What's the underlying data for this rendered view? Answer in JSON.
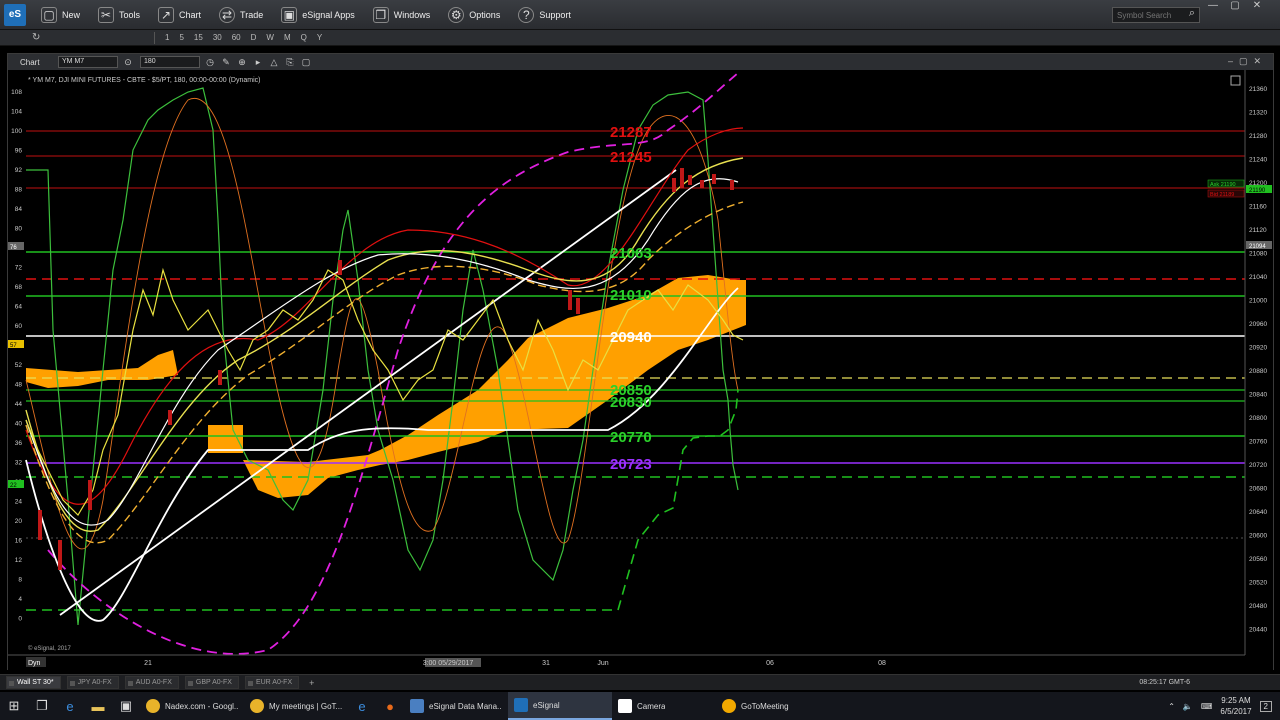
{
  "menubar": {
    "logo": "eS",
    "items": [
      {
        "label": "New",
        "icon": "new-icon"
      },
      {
        "label": "Tools",
        "icon": "tools-icon"
      },
      {
        "label": "Chart",
        "icon": "chart-icon"
      },
      {
        "label": "Trade",
        "icon": "trade-icon"
      },
      {
        "label": "eSignal Apps",
        "icon": "apps-icon"
      },
      {
        "label": "Windows",
        "icon": "windows-icon"
      },
      {
        "label": "Options",
        "icon": "options-icon"
      },
      {
        "label": "Support",
        "icon": "support-icon"
      }
    ],
    "search_placeholder": "Symbol Search"
  },
  "toolbar2": {
    "intervals": [
      "1",
      "5",
      "15",
      "30",
      "60",
      "D",
      "W",
      "M",
      "Q",
      "Y"
    ]
  },
  "chart_window": {
    "tab_label": "Chart",
    "symbol": "YM M7",
    "interval": "180",
    "caption": "* YM M7, DJI MINI FUTURES - CBTE - $5/PT, 180, 00:00-00:00 (Dynamic)",
    "copyright": "© eSignal, 2017",
    "dyn_label": "Dyn",
    "bid_ask": {
      "ask": "Ask 21190",
      "bid": "Bid 21189",
      "last": "21190"
    }
  },
  "chart_data": {
    "type": "line",
    "price_axis": {
      "ticks": [
        "21360",
        "21320",
        "21280",
        "21240",
        "21200",
        "21160",
        "21120",
        "21080",
        "21040",
        "21000",
        "20960",
        "20920",
        "20880",
        "20840",
        "20800",
        "20760",
        "20720",
        "20680",
        "20640",
        "20600",
        "20560",
        "20520",
        "20480",
        "20440"
      ]
    },
    "osc_axis": {
      "ticks": [
        "108",
        "104",
        "100",
        "96",
        "92",
        "88",
        "84",
        "80",
        "76",
        "72",
        "68",
        "64",
        "60",
        "56",
        "52",
        "48",
        "44",
        "40",
        "36",
        "32",
        "28",
        "24",
        "20",
        "16",
        "12",
        "8",
        "4",
        "0"
      ]
    },
    "x_ticks": [
      "21",
      "3:00 05/29/2017",
      "31",
      "Jun",
      "06",
      "08"
    ],
    "level_labels": [
      {
        "text": "21287",
        "color": "#e01010"
      },
      {
        "text": "21245",
        "color": "#e01010"
      },
      {
        "text": "21063",
        "color": "#2bd12b"
      },
      {
        "text": "21010",
        "color": "#2bd12b"
      },
      {
        "text": "20940",
        "color": "#ffffff"
      },
      {
        "text": "20850",
        "color": "#2bd12b"
      },
      {
        "text": "20830",
        "color": "#2bd12b"
      },
      {
        "text": "20770",
        "color": "#2bd12b"
      },
      {
        "text": "20723",
        "color": "#9b30ff"
      }
    ],
    "price_markers": [
      "21094"
    ],
    "osc_markers": [
      "76",
      "57",
      "22"
    ]
  },
  "sheet_tabs": {
    "tabs": [
      "Wall ST 30*",
      "JPY A0-FX",
      "AUD A0-FX",
      "GBP A0-FX",
      "EUR A0-FX"
    ],
    "add": "+",
    "status_time": "08:25:17 GMT-6"
  },
  "taskbar": {
    "apps": [
      {
        "label": "Nadex.com - Googl...",
        "color": "#e8b32a"
      },
      {
        "label": "My meetings | GoT...",
        "color": "#e8b32a"
      },
      {
        "label": "eSignal Data Mana...",
        "color": "#4a7fc1"
      },
      {
        "label": "eSignal",
        "color": "#1f6fb8"
      },
      {
        "label": "Camera",
        "color": "#555555"
      },
      {
        "label": "GoToMeeting",
        "color": "#f2a900"
      }
    ],
    "clock_time": "9:25 AM",
    "clock_date": "6/5/2017",
    "notification_count": "2"
  }
}
